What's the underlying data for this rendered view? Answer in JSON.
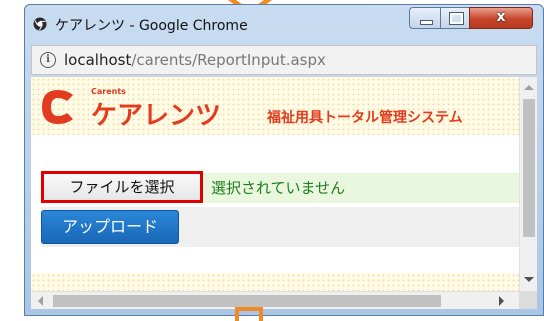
{
  "window": {
    "title": "ケアレンツ - Google Chrome",
    "close_glyph": "x"
  },
  "address": {
    "host": "localhost",
    "path": "/carents/ReportInput.aspx",
    "info_glyph": "i"
  },
  "logo": {
    "small_text": "Carents",
    "main_text": "ケアレンツ",
    "tagline": "福祉用具トータル管理システム"
  },
  "form": {
    "file_button_label": "ファイルを選択",
    "file_status": "選択されていません",
    "upload_button_label": "アップロード"
  },
  "colors": {
    "brand_orange": "#e23b1f",
    "highlight_red": "#e00000",
    "upload_blue": "#1a68b8",
    "callout_orange": "#f08a24"
  },
  "icons": {
    "favicon": "chrome-logo-icon",
    "info": "info-icon"
  }
}
